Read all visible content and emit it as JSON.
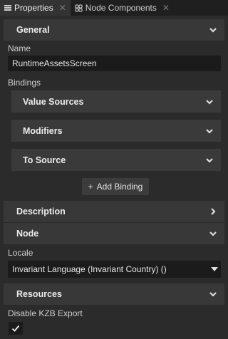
{
  "tabs": [
    {
      "label": "Properties",
      "icon": "list-icon",
      "active": true
    },
    {
      "label": "Node Components",
      "icon": "components-icon",
      "active": false
    }
  ],
  "general": {
    "header": "General",
    "name_label": "Name",
    "name_value": "RuntimeAssetsScreen",
    "bindings_label": "Bindings",
    "binding_groups": [
      "Value Sources",
      "Modifiers",
      "To Source"
    ],
    "add_binding_label": "Add Binding"
  },
  "description": {
    "header": "Description"
  },
  "node": {
    "header": "Node",
    "locale_label": "Locale",
    "locale_value": "Invariant Language (Invariant Country) ()"
  },
  "resources": {
    "header": "Resources",
    "disable_kzb_label": "Disable KZB Export",
    "disable_kzb_checked": true
  },
  "colors": {
    "background": "#2b2b2b",
    "header": "#383838",
    "field": "#1b1b1b"
  }
}
